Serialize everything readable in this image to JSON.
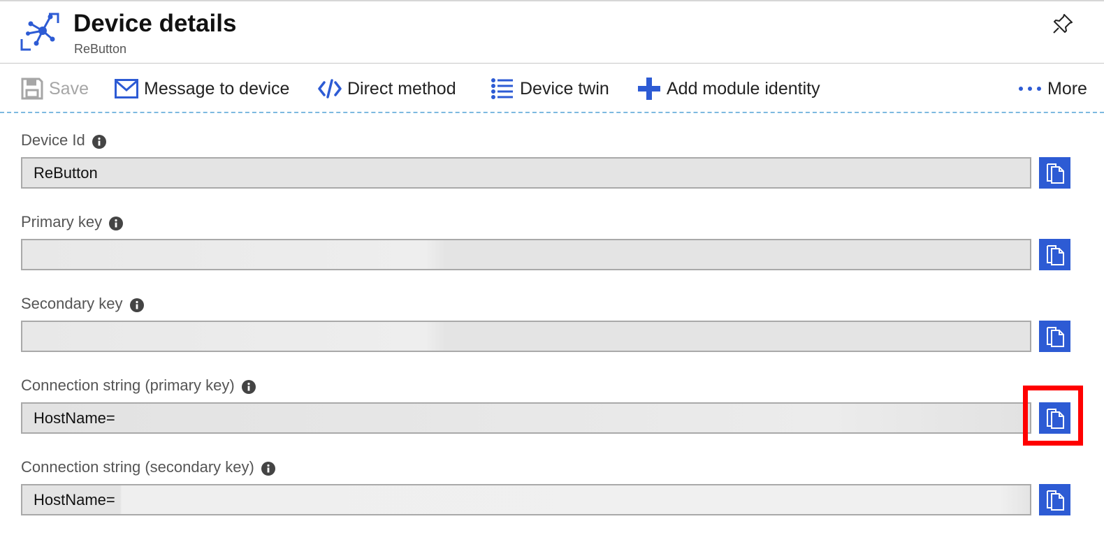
{
  "header": {
    "title": "Device details",
    "subtitle": "ReButton",
    "icon": "iot-hub-device-icon",
    "pin_icon": "pin-icon"
  },
  "toolbar": {
    "save_label": "Save",
    "message_label": "Message to device",
    "direct_method_label": "Direct method",
    "device_twin_label": "Device twin",
    "add_module_label": "Add module identity",
    "more_label": "More"
  },
  "fields": {
    "device_id": {
      "label": "Device Id",
      "value": "ReButton"
    },
    "primary_key": {
      "label": "Primary key",
      "value": ""
    },
    "secondary_key": {
      "label": "Secondary key",
      "value": ""
    },
    "conn_primary": {
      "label": "Connection string (primary key)",
      "value": "HostName="
    },
    "conn_secondary": {
      "label": "Connection string (secondary key)",
      "value": "HostName="
    }
  },
  "colors": {
    "accent": "#2d5bd4",
    "highlight": "#ff0000",
    "field_bg": "#e4e4e4"
  }
}
